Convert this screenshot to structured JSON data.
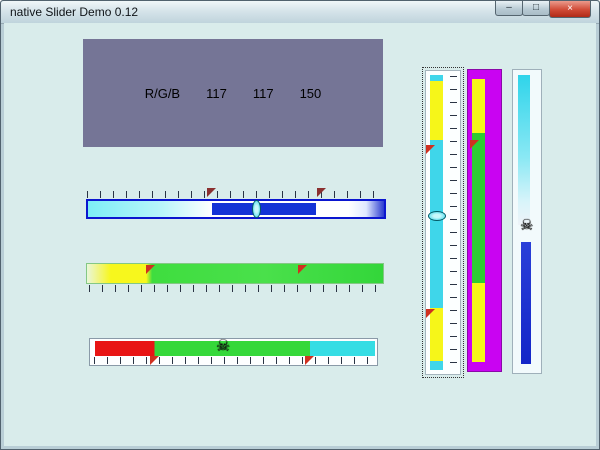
{
  "window": {
    "title": "native Slider Demo 0.12",
    "controls": {
      "minimize": "–",
      "maximize": "□",
      "close": "×"
    }
  },
  "panel": {
    "label": "R/G/B",
    "values": [
      "117",
      "117",
      "150"
    ],
    "bg_color": "#757596"
  },
  "icons": {
    "skull": "☠"
  },
  "colors": {
    "client_bg": "#d9eceb",
    "blue_bar": "#1433d6",
    "cyan_track": "#3fd6ea",
    "yellow_track": "#f7f71d",
    "green_track": "#3fdd3f",
    "red_track": "#e81515",
    "magenta_track": "#c903f2",
    "thumb_cyan": "#2cd4e8",
    "marker_red": "#d03020"
  }
}
